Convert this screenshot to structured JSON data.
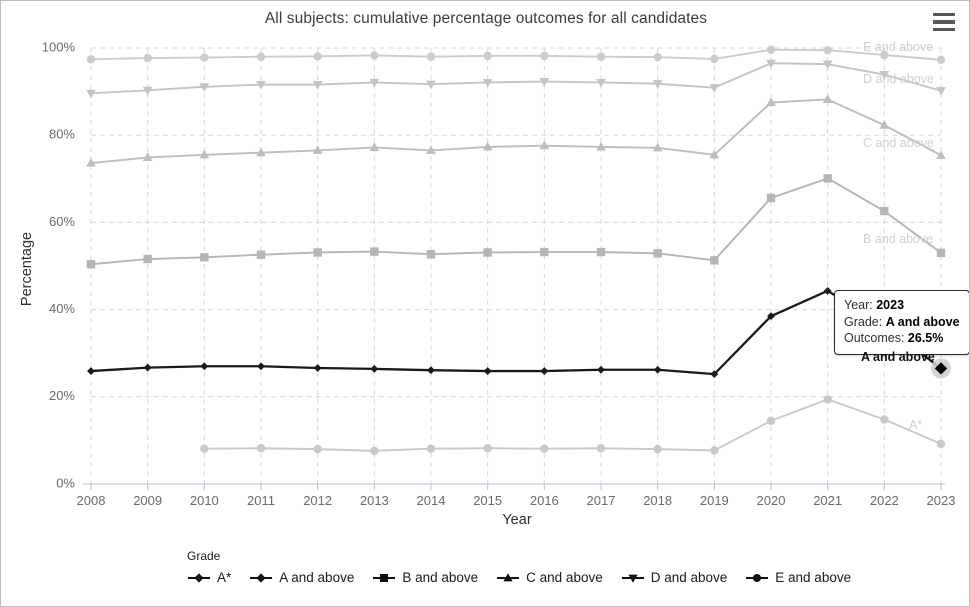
{
  "chart": {
    "title": "All subjects: cumulative percentage outcomes for all candidates",
    "menu_icon": "hamburger-menu-icon"
  },
  "legend": {
    "title": "Grade",
    "items": [
      {
        "label": "A*",
        "marker": "diamond",
        "color": "#c9c9c9"
      },
      {
        "label": "A and above",
        "marker": "diamond",
        "color": "#1a1a1a"
      },
      {
        "label": "B and above",
        "marker": "square",
        "color": "#b5b5b5"
      },
      {
        "label": "C and above",
        "marker": "triangle-up",
        "color": "#bdbdbd"
      },
      {
        "label": "D and above",
        "marker": "triangle-down",
        "color": "#c4c4c4"
      },
      {
        "label": "E and above",
        "marker": "circle",
        "color": "#cccccc"
      }
    ]
  },
  "tooltip": {
    "year_label": "Year:",
    "year_value": "2023",
    "grade_label": "Grade:",
    "grade_value": "A and above",
    "outcomes_label": "Outcomes:",
    "outcomes_value": "26.5%",
    "point_label": "A and above"
  },
  "chart_data": {
    "type": "line",
    "title": "All subjects: cumulative percentage outcomes for all candidates",
    "xlabel": "Year",
    "ylabel": "Percentage",
    "grid": true,
    "legend_position": "bottom",
    "legend_title": "Grade",
    "x": [
      2008,
      2009,
      2010,
      2011,
      2012,
      2013,
      2014,
      2015,
      2016,
      2017,
      2018,
      2019,
      2020,
      2021,
      2022,
      2023
    ],
    "xlim": [
      2008,
      2023
    ],
    "ylim": [
      0,
      100
    ],
    "ytick_labels": [
      "0%",
      "20%",
      "40%",
      "60%",
      "80%",
      "100%"
    ],
    "yticks": [
      0,
      20,
      40,
      60,
      80,
      100
    ],
    "series": [
      {
        "name": "A*",
        "color": "#c9c9c9",
        "marker": "circle",
        "end_label": "A*",
        "values": [
          null,
          null,
          8.1,
          8.2,
          8.0,
          7.6,
          8.1,
          8.2,
          8.1,
          8.2,
          8.0,
          7.7,
          14.5,
          19.4,
          14.8,
          9.2
        ]
      },
      {
        "name": "A and above",
        "color": "#1a1a1a",
        "marker": "diamond",
        "end_label": "A and above",
        "values": [
          25.9,
          26.7,
          27.0,
          27.0,
          26.6,
          26.4,
          26.1,
          25.9,
          25.9,
          26.2,
          26.2,
          25.2,
          38.5,
          44.3,
          36.4,
          26.5
        ]
      },
      {
        "name": "B and above",
        "color": "#b5b5b5",
        "marker": "square",
        "end_label": "B and above",
        "values": [
          50.4,
          51.6,
          52.0,
          52.6,
          53.1,
          53.3,
          52.7,
          53.1,
          53.2,
          53.2,
          52.9,
          51.3,
          65.6,
          70.1,
          62.6,
          53.0
        ]
      },
      {
        "name": "C and above",
        "color": "#bdbdbd",
        "marker": "triangle-up",
        "end_label": "C and above",
        "values": [
          73.6,
          74.9,
          75.5,
          76.0,
          76.5,
          77.2,
          76.5,
          77.3,
          77.6,
          77.3,
          77.1,
          75.5,
          87.5,
          88.2,
          82.3,
          75.4
        ]
      },
      {
        "name": "D and above",
        "color": "#c4c4c4",
        "marker": "triangle-down",
        "end_label": "D and above",
        "values": [
          89.6,
          90.3,
          91.1,
          91.6,
          91.6,
          92.1,
          91.7,
          92.1,
          92.3,
          92.1,
          91.8,
          90.9,
          96.5,
          96.3,
          93.9,
          90.2
        ]
      },
      {
        "name": "E and above",
        "color": "#cccccc",
        "marker": "circle",
        "end_label": "E and above",
        "values": [
          97.4,
          97.7,
          97.8,
          98.0,
          98.1,
          98.3,
          98.0,
          98.2,
          98.2,
          98.0,
          97.9,
          97.5,
          99.6,
          99.5,
          98.4,
          97.3
        ]
      }
    ],
    "highlight_point": {
      "series": "A and above",
      "x": 2023,
      "y": 26.5
    }
  }
}
